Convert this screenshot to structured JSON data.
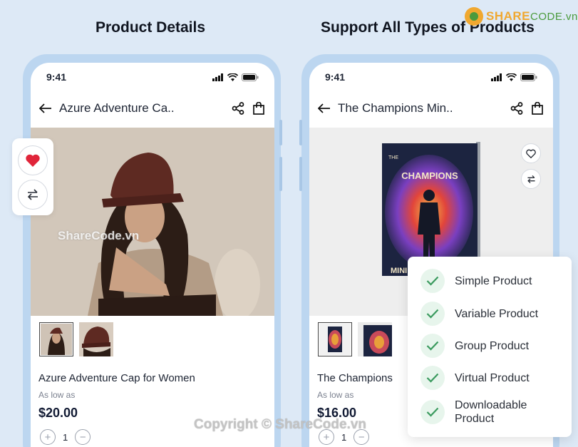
{
  "headings": {
    "left": "Product Details",
    "right": "Support All Types of Products"
  },
  "logo": {
    "brand_main": "SHARE",
    "brand_rest": "CODE.vn"
  },
  "watermark": "ShareCode.vn",
  "copyright": "Copyright © ShareCode.vn",
  "phones": [
    {
      "time": "9:41",
      "title": "Azure Adventure Ca..",
      "product_name": "Azure Adventure Cap for Women",
      "low_label": "As low as",
      "price": "$20.00",
      "quantity": "1",
      "icons": [
        "back-arrow-icon",
        "share-icon",
        "bag-icon"
      ]
    },
    {
      "time": "9:41",
      "title": "The Champions Min..",
      "product_name": "The Champions",
      "low_label": "As low as",
      "price": "$16.00",
      "quantity": "1",
      "book_title": "CHAMPIONS",
      "book_prefix": "THE",
      "book_bottom": "MINI",
      "icons": [
        "back-arrow-icon",
        "share-icon",
        "bag-icon",
        "heart-outline-icon",
        "compare-icon"
      ]
    }
  ],
  "product_types": [
    "Simple Product",
    "Variable Product",
    "Group Product",
    "Virtual Product",
    "Downloadable Product"
  ],
  "colors": {
    "background": "#dde9f6",
    "check_green": "#3a9a5e",
    "heart_red": "#e0253a"
  }
}
